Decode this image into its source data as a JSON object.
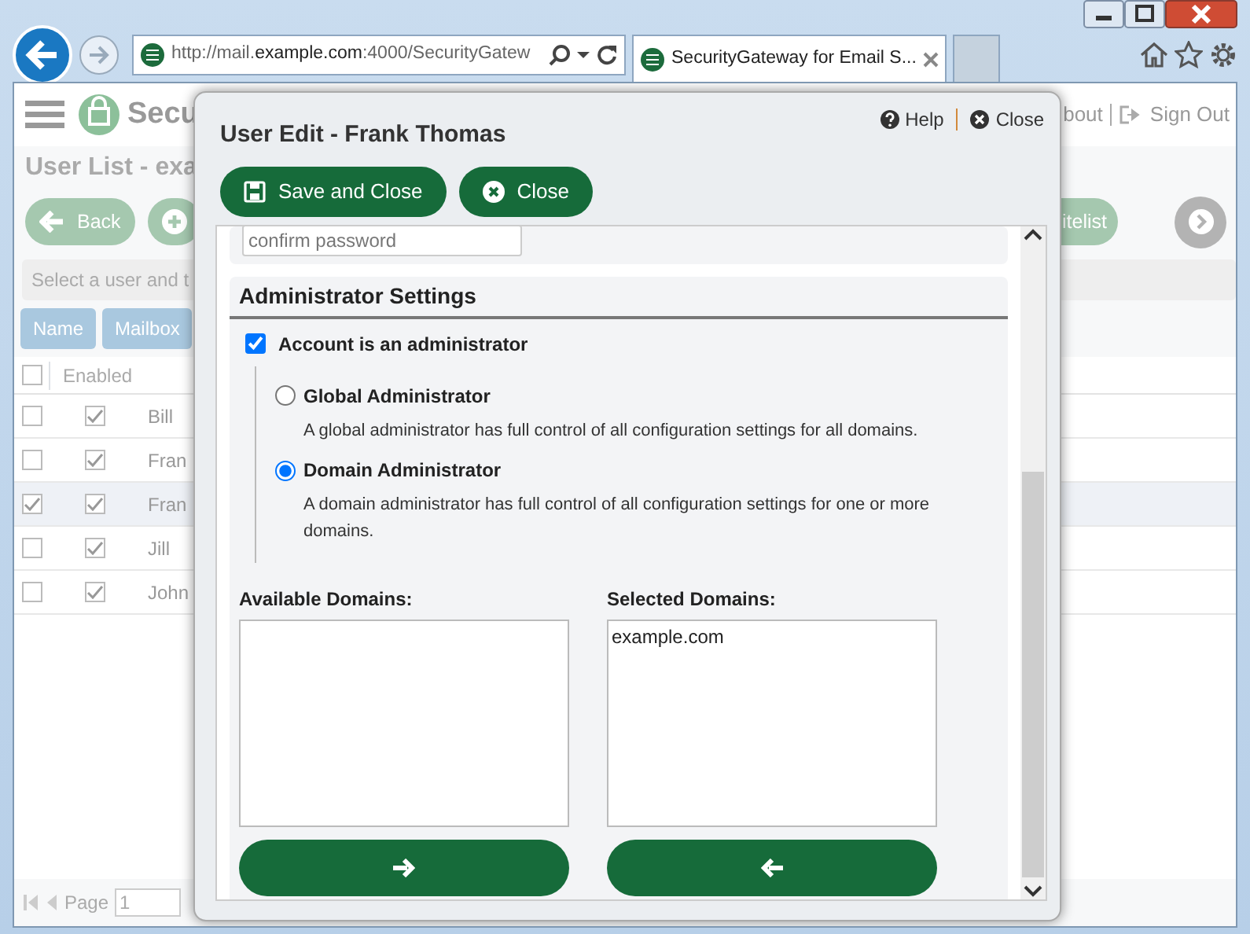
{
  "browser": {
    "address": {
      "prefix": "http://mail.",
      "host": "example.com",
      "suffix": ":4000/SecurityGatew"
    },
    "tabs": [
      {
        "label": "SecurityGateway for Email S...",
        "selected": true
      }
    ]
  },
  "app": {
    "logo_text": "Secu",
    "header_links": [
      {
        "kind": "about",
        "label": "bout"
      },
      {
        "kind": "signout",
        "label": "Sign Out"
      }
    ],
    "page_title": "User List - exa",
    "toolbar_left": [
      {
        "kind": "back",
        "label": "Back"
      },
      {
        "kind": "add"
      }
    ],
    "toolbar_right": [
      {
        "kind": "text",
        "label": "itelist"
      },
      {
        "kind": "next"
      }
    ],
    "filter": {
      "placeholder": "Select a user and t"
    },
    "column_buttons": [
      "Name",
      "Mailbox"
    ],
    "table": {
      "all_selected": false,
      "columns": [
        "Enabled"
      ],
      "rows": [
        {
          "selected": false,
          "enabled": true,
          "name": "Bill"
        },
        {
          "selected": false,
          "enabled": true,
          "name": "Fran"
        },
        {
          "selected": true,
          "enabled": true,
          "name": "Fran"
        },
        {
          "selected": false,
          "enabled": true,
          "name": "Jill"
        },
        {
          "selected": false,
          "enabled": true,
          "name": "John"
        }
      ]
    },
    "pager": {
      "label": "Page",
      "value": "1"
    }
  },
  "dialog": {
    "title": "User Edit - Frank Thomas",
    "help": "Help",
    "close": "Close",
    "buttons": [
      {
        "kind": "save",
        "label": "Save and Close"
      },
      {
        "kind": "close",
        "label": "Close"
      }
    ],
    "password_field": {
      "placeholder": "confirm password"
    },
    "section_title": "Administrator Settings",
    "admin_checkbox": {
      "label": "Account is an administrator",
      "checked": true
    },
    "roles": [
      {
        "label": "Global Administrator",
        "description": "A global administrator has full control of all configuration settings for all domains.",
        "selected": false
      },
      {
        "label": "Domain Administrator",
        "description": "A domain administrator has full control of all configuration settings for one or more domains.",
        "selected": true
      }
    ],
    "available_domains": {
      "label": "Available Domains:"
    },
    "selected_domains": {
      "label": "Selected Domains:",
      "items": [
        "example.com"
      ]
    },
    "move_buttons": [
      {
        "kind": "add"
      },
      {
        "kind": "remove"
      }
    ]
  }
}
